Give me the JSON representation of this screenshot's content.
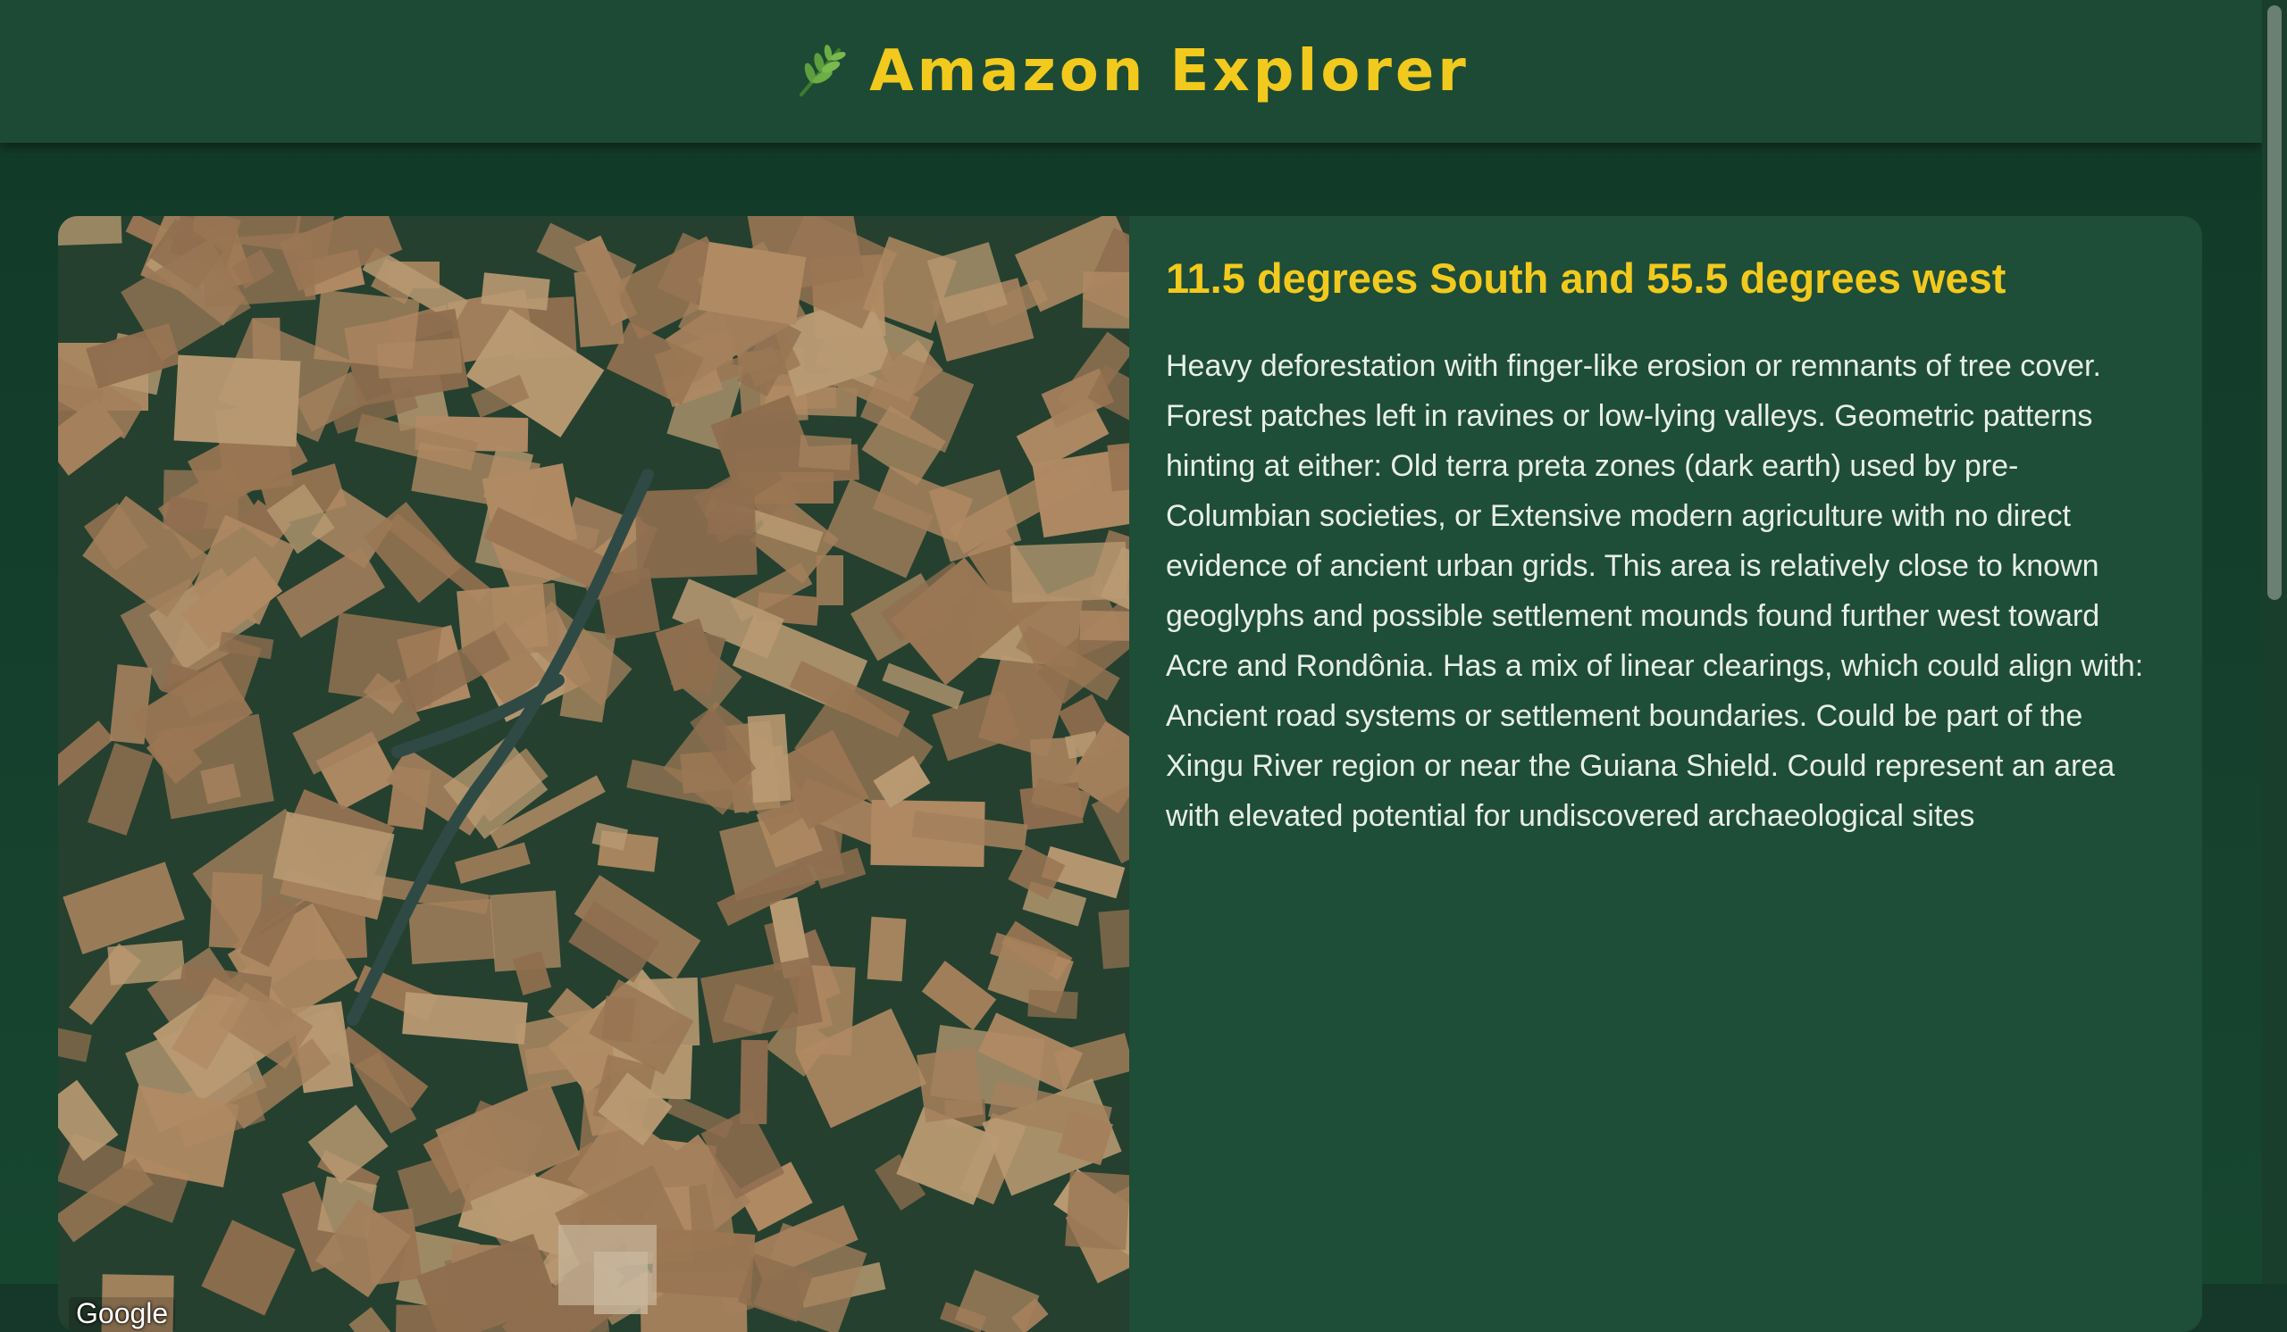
{
  "header": {
    "title": "Amazon Explorer",
    "icon": "leaf-icon"
  },
  "map": {
    "attribution": "Google",
    "image": "satellite view of deforested forest region"
  },
  "location": {
    "title": "11.5 degrees South and 55.5 degrees west",
    "description": "Heavy deforestation with finger-like erosion or remnants of tree cover. Forest patches left in ravines or low-lying valleys. Geometric patterns hinting at either: Old terra preta zones (dark earth) used by pre-Columbian societies, or Extensive modern agriculture with no direct evidence of ancient urban grids. This area is relatively close to known geoglyphs and possible settlement mounds found further west toward Acre and Rondônia. Has a mix of linear clearings, which could align with: Ancient road systems or settlement boundaries. Could be part of the Xingu River region or near the Guiana Shield. Could represent an area with elevated potential for undiscovered archaeological sites"
  },
  "colors": {
    "header_bg": "#1d4a34",
    "page_bg": "#15382a",
    "card_bg": "#1e4d38",
    "accent": "#f2c91d",
    "text": "#e8eee9"
  }
}
